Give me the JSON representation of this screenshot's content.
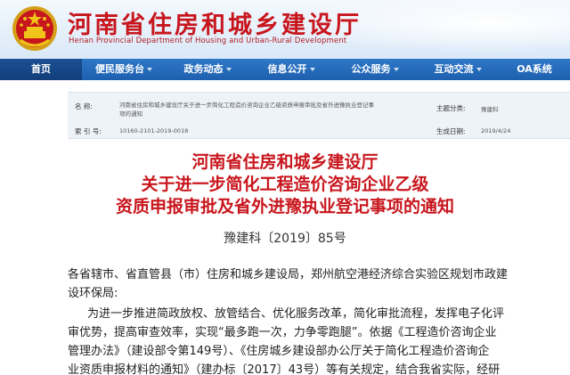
{
  "header": {
    "title": "河南省住房和城乡建设厅",
    "subtitle": "Henan Provincial Department of Housing and Urban-Rural Development"
  },
  "nav": {
    "items": [
      {
        "label": "首页",
        "active": true,
        "dropdown": false
      },
      {
        "label": "便民服务台",
        "active": false,
        "dropdown": true
      },
      {
        "label": "政务动态",
        "active": false,
        "dropdown": true
      },
      {
        "label": "信息公开",
        "active": false,
        "dropdown": true
      },
      {
        "label": "公众服务",
        "active": false,
        "dropdown": true
      },
      {
        "label": "互动交流",
        "active": false,
        "dropdown": true
      },
      {
        "label": "OA系统",
        "active": false,
        "dropdown": false
      }
    ]
  },
  "meta": {
    "name_label": "名  称:",
    "name_value_line1": "河南省住房和城乡建设厅关于进一步简化工程造价咨询企业乙级资质申报审批及省外进豫执业登记事",
    "name_value_line2": "项的通知",
    "index_label": "索 引 号:",
    "index_value": "10160-2101-2019-0018",
    "subject_label": "主题分类:",
    "subject_value": "豫建科",
    "date_label": "生成日期:",
    "date_value": "2019/4/24"
  },
  "document": {
    "title_line1": "河南省住房和城乡建设厅",
    "title_line2": "关于进一步简化工程造价咨询企业乙级",
    "title_line3": "资质申报审批及省外进豫执业登记事项的通知",
    "number": "豫建科〔2019〕85号",
    "addressee_line1": "各省辖市、省直管县（市）住房和城乡建设局，郑州航空港经济综合实验区规划市政建",
    "addressee_line2": "设环保局:",
    "body_line1": "为进一步推进简政放权、放管结合、优化服务改革，简化审批流程，发挥电子化评",
    "body_line2": "审优势，提高审查效率，实现“最多跑一次，力争零跑腿”。依据《工程造价咨询企业",
    "body_line3": "管理办法》（建设部令第149号）、《住房城乡建设部办公厅关于简化工程造价咨询企",
    "body_line4": "业资质申报材料的通知》（建办标〔2017〕43号）等有关规定，结合我省实际，经研"
  },
  "colors": {
    "brand_red": "#c8161d",
    "nav_blue": "#1d5fae",
    "nav_active": "#123e7a"
  },
  "icons": {
    "emblem": "national-emblem-icon",
    "nav_dropdown": "dropdown-arrow-icon"
  }
}
